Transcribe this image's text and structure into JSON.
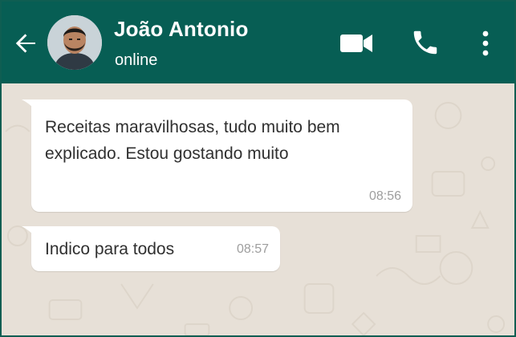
{
  "header": {
    "contact_name": "João Antonio",
    "status": "online",
    "icons": [
      "back-arrow-icon",
      "video-call-icon",
      "phone-call-icon",
      "more-options-icon"
    ]
  },
  "messages": [
    {
      "text": "Receitas maravilhosas, tudo muito bem explicado. Estou gostando muito",
      "time": "08:56"
    },
    {
      "text": "Indico para todos",
      "time": "08:57"
    }
  ],
  "colors": {
    "header_bg": "#075e54",
    "chat_bg": "#e7e0d7",
    "bubble_bg": "#ffffff",
    "time_text": "#9e9e9e"
  }
}
